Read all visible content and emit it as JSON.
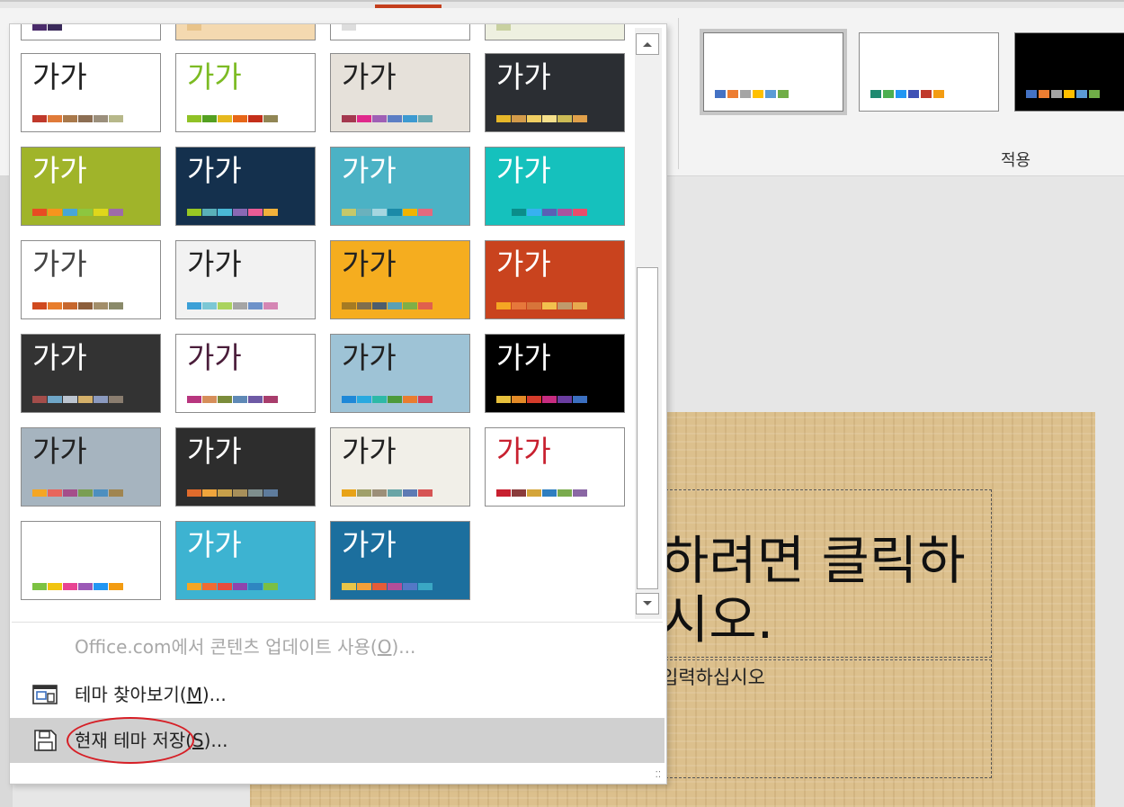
{
  "ribbon": {
    "group_label": "적용",
    "variants": [
      {
        "name": "variant-white-1",
        "bg": "#ffffff",
        "colors": [
          "#4472c4",
          "#ed7d31",
          "#a5a5a5",
          "#ffc000",
          "#5b9bd5",
          "#70ad47"
        ]
      },
      {
        "name": "variant-white-2",
        "bg": "#ffffff",
        "colors": [
          "#1f8a70",
          "#4caf50",
          "#2196f3",
          "#3f51b5",
          "#c0392b",
          "#f39c12"
        ]
      },
      {
        "name": "variant-black",
        "bg": "#000000",
        "colors": [
          "#4472c4",
          "#ed7d31",
          "#a5a5a5",
          "#ffc000",
          "#5b9bd5",
          "#70ad47"
        ]
      }
    ]
  },
  "gallery": {
    "sample_text": "가가",
    "themes": [
      {
        "name": "theme-top-1",
        "bg": "#ffffff",
        "text": "#222222",
        "colors": [
          "#4a2b6b",
          "#3a2a5a"
        ]
      },
      {
        "name": "theme-top-2",
        "bg": "#f4d9b0",
        "text": "#222222",
        "colors": [
          "#e8c38a"
        ]
      },
      {
        "name": "theme-top-3",
        "bg": "#ffffff",
        "text": "#222222",
        "colors": [
          "#dddddd"
        ]
      },
      {
        "name": "theme-top-4",
        "bg": "#eef0e0",
        "text": "#222222",
        "colors": [
          "#c8d0a0"
        ]
      },
      {
        "name": "theme-office",
        "bg": "#ffffff",
        "text": "#222222",
        "colors": [
          "#c0392b",
          "#e07b39",
          "#a9794b",
          "#8c6e53",
          "#9b8f7c",
          "#b7b88a"
        ]
      },
      {
        "name": "theme-facet",
        "bg": "#ffffff",
        "text": "#7cbb23",
        "colors": [
          "#90c226",
          "#54a021",
          "#e6b91e",
          "#e76618",
          "#c42f1a",
          "#918655"
        ]
      },
      {
        "name": "theme-ion-boardroom",
        "bg": "#e6e1da",
        "text": "#222222",
        "colors": [
          "#a4384f",
          "#e0288b",
          "#9f5fb5",
          "#5c7ec4",
          "#3d9ad1",
          "#69a9b2"
        ]
      },
      {
        "name": "theme-dark-texture",
        "bg": "#2b2e33",
        "text": "#ffffff",
        "colors": [
          "#e6b729",
          "#d39b4a",
          "#f0ce62",
          "#f6e08b",
          "#ccbb55",
          "#e0a04a"
        ]
      },
      {
        "name": "theme-green",
        "bg": "#a0b42a",
        "text": "#ffffff",
        "colors": [
          "#e84c22",
          "#f7941d",
          "#47a6d7",
          "#8dc63f",
          "#dfd71b",
          "#9e6ba8"
        ]
      },
      {
        "name": "theme-dark-blue",
        "bg": "#14304d",
        "text": "#ffffff",
        "colors": [
          "#98c723",
          "#59b0b9",
          "#4ab8d6",
          "#8968b4",
          "#ea5c96",
          "#f2b13b"
        ]
      },
      {
        "name": "theme-teal",
        "bg": "#4bb2c5",
        "text": "#ffffff",
        "colors": [
          "#c4c86a",
          "#6ab1bd",
          "#a5d6e0",
          "#1b8aa8",
          "#f0b400",
          "#e2697e"
        ]
      },
      {
        "name": "theme-aqua",
        "bg": "#15c1bd",
        "text": "#ffffff",
        "colors": [
          "#15c1bd",
          "#0b8d8a",
          "#37b1f0",
          "#5a60b5",
          "#a9539f",
          "#e94d6b"
        ]
      },
      {
        "name": "theme-gray-paper",
        "bg": "#ffffff",
        "text": "#444444",
        "colors": [
          "#d04a1f",
          "#e87d2c",
          "#c7672d",
          "#8c5e3b",
          "#a28e6a",
          "#8a8a6a"
        ]
      },
      {
        "name": "theme-droplet",
        "bg": "#f2f2f2",
        "text": "#222222",
        "colors": [
          "#3ca0d7",
          "#7cc7d5",
          "#aad35f",
          "#a5a5a5",
          "#6e92c9",
          "#d586b4"
        ]
      },
      {
        "name": "theme-orange-circle",
        "bg": "#f5ad1f",
        "text": "#222222",
        "colors": [
          "#a57b23",
          "#7f6e4d",
          "#4d5d6c",
          "#5aa0b4",
          "#7faf47",
          "#e0604d"
        ]
      },
      {
        "name": "theme-orange-red",
        "bg": "#c9431e",
        "text": "#ffffff",
        "colors": [
          "#f5a623",
          "#e6783b",
          "#d7743a",
          "#f2c14e",
          "#bf9a6b",
          "#e8aa4e"
        ]
      },
      {
        "name": "theme-charcoal",
        "bg": "#333333",
        "text": "#ffffff",
        "colors": [
          "#a34d4a",
          "#6fa6c7",
          "#bcc5d0",
          "#d4b06a",
          "#8b9abf",
          "#8a7d6f"
        ]
      },
      {
        "name": "theme-maroon",
        "bg": "#ffffff",
        "text": "#4a1d3a",
        "colors": [
          "#b8367f",
          "#d68e5a",
          "#7b8c3b",
          "#5f89b6",
          "#6e5aa5",
          "#a83d6c"
        ]
      },
      {
        "name": "theme-blue-pattern",
        "bg": "#9ec3d6",
        "text": "#222222",
        "colors": [
          "#1e88d8",
          "#28a9e0",
          "#2db9a7",
          "#4c9a3b",
          "#e97c2f",
          "#d03c5c"
        ]
      },
      {
        "name": "theme-black-wave",
        "bg": "#000000",
        "text": "#ffffff",
        "colors": [
          "#e7c03c",
          "#e38a27",
          "#d53c2b",
          "#c72c80",
          "#6a3da0",
          "#3b6fc0"
        ]
      },
      {
        "name": "theme-blue-gray",
        "bg": "#a6b4bf",
        "text": "#222222",
        "colors": [
          "#f5a623",
          "#e8655c",
          "#a54e8a",
          "#7a9e52",
          "#4d8fbf",
          "#a08550"
        ]
      },
      {
        "name": "theme-dark-gray",
        "bg": "#2d2d2d",
        "text": "#ffffff",
        "colors": [
          "#e06b2c",
          "#f0a53c",
          "#c8a04a",
          "#a8905a",
          "#7f8f8e",
          "#5e7c9d"
        ]
      },
      {
        "name": "theme-frame",
        "bg": "#f1efe8",
        "text": "#222222",
        "colors": [
          "#e8a317",
          "#a0a06a",
          "#9c8f78",
          "#69a5a6",
          "#5e7bb4",
          "#d65454"
        ]
      },
      {
        "name": "theme-red-card",
        "bg": "#ffffff",
        "text": "#c8202f",
        "colors": [
          "#c8202f",
          "#8a3b3b",
          "#d4a53a",
          "#2e7ec0",
          "#7aab4e",
          "#8a67a4"
        ]
      },
      {
        "name": "theme-blue-band",
        "bg": "#ffffff",
        "text": "#ffffff",
        "colors": [
          "#7cc242",
          "#f1c40f",
          "#e84393",
          "#9b59b6",
          "#2196f3",
          "#f39c12"
        ]
      },
      {
        "name": "theme-cyan-gray",
        "bg": "#3db3d1",
        "text": "#ffffff",
        "colors": [
          "#f5a623",
          "#f06b32",
          "#e84c3d",
          "#8e44ad",
          "#2e86c1",
          "#7bbf44"
        ]
      },
      {
        "name": "theme-ocean",
        "bg": "#1c6f9e",
        "text": "#ffffff",
        "colors": [
          "#e8c548",
          "#f2a03a",
          "#e45c38",
          "#b34e99",
          "#5478c6",
          "#3aa7c4"
        ]
      }
    ]
  },
  "menu": {
    "update_label": "Office.com에서 콘텐츠 업데이트 사용(",
    "update_key": "O",
    "update_suffix": ")...",
    "browse_label": "테마 찾아보기(",
    "browse_key": "M",
    "browse_suffix": ")...",
    "save_label": "현재 테마 저장(",
    "save_key": "S",
    "save_suffix": ")..."
  },
  "slide": {
    "title_text": "하려면 클릭하\n시오.",
    "subtitle_text": "입력하십시오"
  },
  "colors": {
    "accent": "#c43e1c",
    "highlight": "#d0d0d0",
    "annotation": "#d61f26"
  }
}
